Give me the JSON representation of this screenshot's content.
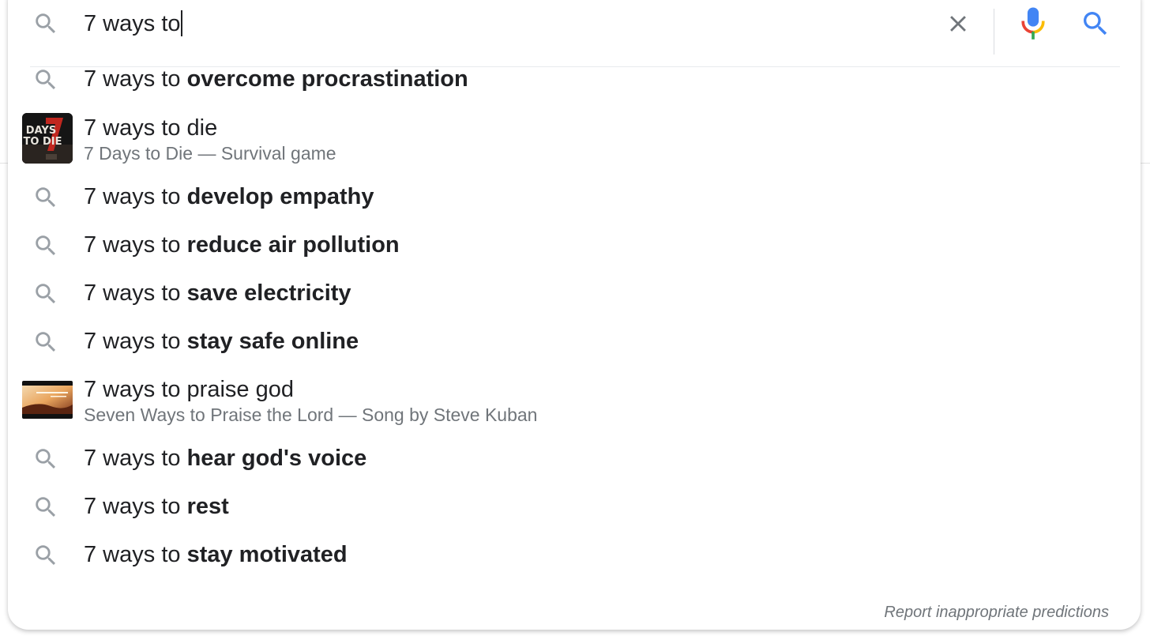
{
  "search": {
    "query": "7 ways to"
  },
  "icons": {
    "search": "search-icon",
    "clear": "close-icon",
    "mic": "microphone-icon",
    "submit": "search-submit-icon"
  },
  "colors": {
    "icon_gray": "#9aa0a6",
    "clear_gray": "#70757a",
    "google_blue": "#4285f4",
    "google_red": "#ea4335",
    "google_yellow": "#fbbc04",
    "google_green": "#34a853",
    "subtitle_gray": "#70757a"
  },
  "suggestions": [
    {
      "prefix": "7 ways to ",
      "completion": "overcome procrastination"
    },
    {
      "prefix": "7 ways to die",
      "completion": "",
      "subtitle": "7 Days to Die — Survival game",
      "thumbnail_text": "DAYS TO DIE",
      "thumbnail_numeral": "7"
    },
    {
      "prefix": "7 ways to ",
      "completion": "develop empathy"
    },
    {
      "prefix": "7 ways to ",
      "completion": "reduce air pollution"
    },
    {
      "prefix": "7 ways to ",
      "completion": "save electricity"
    },
    {
      "prefix": "7 ways to ",
      "completion": "stay safe online"
    },
    {
      "prefix": "7 ways to praise god",
      "completion": "",
      "subtitle": "Seven Ways to Praise the Lord — Song by Steve Kuban"
    },
    {
      "prefix": "7 ways to ",
      "completion": "hear god's voice"
    },
    {
      "prefix": "7 ways to ",
      "completion": "rest"
    },
    {
      "prefix": "7 ways to ",
      "completion": "stay motivated"
    }
  ],
  "footer": {
    "report_link": "Report inappropriate predictions"
  }
}
